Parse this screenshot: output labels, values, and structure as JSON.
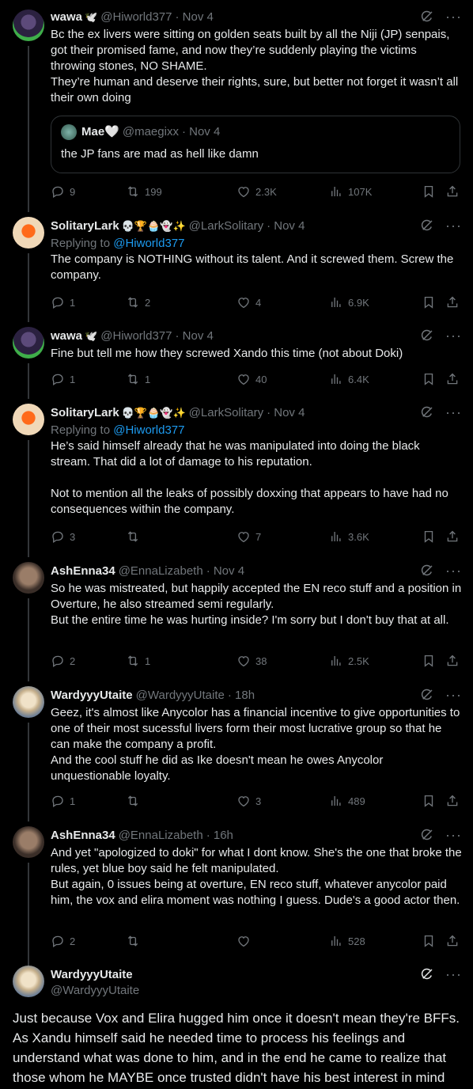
{
  "tweets": [
    {
      "name": "wawa",
      "badges": "🕊️",
      "handle": "@Hiworld377",
      "date": "· Nov 4",
      "text": "Bc the ex livers were sitting on golden seats built by all the Niji (JP) senpais, got their promised fame, and now they’re suddenly playing the victims throwing stones, NO SHAME.\nThey’re human and deserve their rights, sure, but better not forget it wasn’t all their own doing",
      "quote": {
        "name": "Mae🤍",
        "handle": "@maegixx",
        "date": "· Nov 4",
        "text": "the JP fans are mad as hell like damn"
      },
      "replies": "9",
      "retweets": "199",
      "likes": "2.3K",
      "views": "107K"
    },
    {
      "name": "SolitaryLark",
      "badges": "💀🏆🧁👻✨",
      "handle": "@LarkSolitary",
      "date": "· Nov 4",
      "replying_prefix": "Replying to ",
      "replying_to": "@Hiworld377",
      "text": "The company is NOTHING without its talent. And it screwed them. Screw the company.",
      "replies": "1",
      "retweets": "2",
      "likes": "4",
      "views": "6.9K"
    },
    {
      "name": "wawa",
      "badges": "🕊️",
      "handle": "@Hiworld377",
      "date": "· Nov 4",
      "text": "Fine but tell me how they screwed Xando this time (not about Doki)",
      "replies": "1",
      "retweets": "1",
      "likes": "40",
      "views": "6.4K"
    },
    {
      "name": "SolitaryLark",
      "badges": "💀🏆🧁👻✨",
      "handle": "@LarkSolitary",
      "date": "· Nov 4",
      "replying_prefix": "Replying to ",
      "replying_to": "@Hiworld377",
      "text": "He’s said himself already that he was manipulated into doing the black stream. That did a lot of damage to his reputation.\n\nNot to mention all the leaks of possibly doxxing that appears to have had no consequences within the company.",
      "replies": "3",
      "retweets": "",
      "likes": "7",
      "views": "3.6K"
    },
    {
      "name": "AshEnna34",
      "badges": "",
      "handle": "@EnnaLizabeth",
      "date": "· Nov 4",
      "text": "So he was mistreated, but happily accepted the EN reco stuff and a position in Overture, he also streamed semi regularly.\nBut the entire time he was hurting inside? I'm sorry but I don't buy that at all.",
      "replies": "2",
      "retweets": "1",
      "likes": "38",
      "views": "2.5K"
    },
    {
      "name": "WardyyyUtaite",
      "badges": "",
      "handle": "@WardyyyUtaite",
      "date": "· 18h",
      "text": "Geez, it's almost like Anycolor has a financial incentive to give opportunities to one of their most sucessful livers form their most lucrative group so that he can make the company a profit.\nAnd the cool stuff he did as Ike doesn't mean he owes Anycolor unquestionable loyalty.",
      "replies": "1",
      "retweets": "",
      "likes": "3",
      "views": "489"
    },
    {
      "name": "AshEnna34",
      "badges": "",
      "handle": "@EnnaLizabeth",
      "date": "· 16h",
      "text": "And yet \"apologized to doki\" for what I dont know. She's the one that broke the rules, yet blue boy said he felt manipulated.\nBut again, 0 issues being at overture, EN reco stuff, whatever anycolor paid him, the vox and elira moment was nothing I guess. Dude's a good actor then.",
      "replies": "2",
      "retweets": "",
      "likes": "",
      "views": "528"
    }
  ],
  "main_tweet": {
    "name": "WardyyyUtaite",
    "handle": "@WardyyyUtaite",
    "text": "Just because Vox and Elira hugged him once it doesn't mean they're BFFs. As Xandu himself said he needed time to process his feelings and understand what was done to him, and in the end he came to realize that those whom he MAYBE once trusted didn't have his best interest in mind"
  },
  "icons": {
    "reply": "reply-icon",
    "retweet": "retweet-icon",
    "like": "heart-icon",
    "views": "views-icon",
    "bookmark": "bookmark-icon",
    "share": "share-icon",
    "grok": "grok-icon",
    "more": "more-icon"
  },
  "colors": {
    "background": "#000000",
    "text": "#e7e9ea",
    "muted": "#71767b",
    "link": "#1d9bf0",
    "border": "#2f3336"
  }
}
